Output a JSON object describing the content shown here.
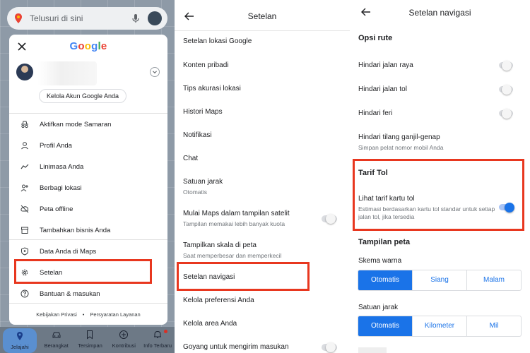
{
  "colors": {
    "accent": "#1a73e8",
    "highlight": "#e8371f"
  },
  "panel1": {
    "search_placeholder": "Telusuri di sini",
    "logo_letters": [
      "G",
      "o",
      "o",
      "g",
      "l",
      "e"
    ],
    "logo_colors": [
      "#4285f4",
      "#ea4335",
      "#fbbc05",
      "#4285f4",
      "#34a853",
      "#ea4335"
    ],
    "manage_account": "Kelola Akun Google Anda",
    "menu": [
      {
        "label": "Aktifkan mode Samaran",
        "icon": "incognito-icon"
      },
      {
        "label": "Profil Anda",
        "icon": "person-icon"
      },
      {
        "label": "Linimasa Anda",
        "icon": "timeline-icon"
      },
      {
        "label": "Berbagi lokasi",
        "icon": "location-sharing-icon"
      },
      {
        "label": "Peta offline",
        "icon": "offline-map-icon"
      },
      {
        "label": "Tambahkan bisnis Anda",
        "icon": "store-icon"
      },
      {
        "label": "Data Anda di Maps",
        "icon": "shield-icon"
      },
      {
        "label": "Setelan",
        "icon": "gear-icon"
      },
      {
        "label": "Bantuan & masukan",
        "icon": "help-icon"
      }
    ],
    "footer": {
      "privacy": "Kebijakan Privasi",
      "dot": "•",
      "terms": "Persyaratan Layanan"
    },
    "bottom_nav": [
      {
        "label": "Jelajahi",
        "icon": "pin-icon"
      },
      {
        "label": "Berangkat",
        "icon": "car-icon"
      },
      {
        "label": "Tersimpan",
        "icon": "bookmark-icon"
      },
      {
        "label": "Kontribusi",
        "icon": "add-circle-icon"
      },
      {
        "label": "Info Terbaru",
        "icon": "bell-icon"
      }
    ]
  },
  "panel2": {
    "title": "Setelan",
    "items": [
      {
        "label": "Setelan lokasi Google",
        "sub": ""
      },
      {
        "label": "Konten pribadi",
        "sub": ""
      },
      {
        "label": "Tips akurasi lokasi",
        "sub": ""
      },
      {
        "label": "Histori Maps",
        "sub": ""
      },
      {
        "label": "Notifikasi",
        "sub": ""
      },
      {
        "label": "Chat",
        "sub": ""
      },
      {
        "label": "Satuan jarak",
        "sub": "Otomatis"
      },
      {
        "label": "Mulai Maps dalam tampilan satelit",
        "sub": "Tampilan memakai lebih banyak kuota"
      },
      {
        "label": "Tampilkan skala di peta",
        "sub": "Saat memperbesar dan memperkecil"
      },
      {
        "label": "Setelan navigasi",
        "sub": ""
      },
      {
        "label": "Kelola preferensi Anda",
        "sub": ""
      },
      {
        "label": "Kelola area Anda",
        "sub": ""
      },
      {
        "label": "Goyang untuk mengirim masukan",
        "sub": ""
      }
    ]
  },
  "panel3": {
    "title": "Setelan navigasi",
    "route_options": "Opsi rute",
    "avoid_highways": "Hindari jalan raya",
    "avoid_tolls": "Hindari jalan tol",
    "avoid_ferries": "Hindari feri",
    "odd_even_label": "Hindari tilang ganjil-genap",
    "odd_even_sub": "Simpan pelat nomor mobil Anda",
    "toll_section": "Tarif Tol",
    "toll_label": "Lihat tarif kartu tol",
    "toll_sub": "Estimasi berdasarkan kartu tol standar untuk setiap jalan tol, jika tersedia",
    "map_display": "Tampilan peta",
    "color_scheme": "Skema warna",
    "color_options": [
      "Otomatis",
      "Siang",
      "Malam"
    ],
    "distance_units": "Satuan jarak",
    "distance_options": [
      "Otomatis",
      "Kilometer",
      "Mil"
    ]
  }
}
